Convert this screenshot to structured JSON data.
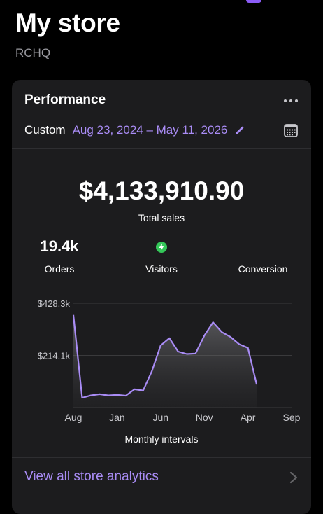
{
  "header": {
    "title": "My store",
    "subtitle": "RCHQ"
  },
  "card": {
    "title": "Performance",
    "more_icon": "more-horizontal-icon",
    "range_label": "Custom",
    "range_dates": "Aug 23, 2024 – May 11, 2026",
    "edit_icon": "pencil-icon",
    "calendar_icon": "calendar-icon",
    "total_value": "$4,133,910.90",
    "total_label": "Total sales",
    "metrics": [
      {
        "value": "19.4k",
        "label": "Orders"
      },
      {
        "value": "",
        "label": "Visitors",
        "icon": "lightning-badge-icon"
      },
      {
        "value": "",
        "label": "Conversion"
      }
    ],
    "interval_label": "Monthly intervals",
    "footer_link": "View all store analytics",
    "footer_icon": "chevron-right-icon"
  },
  "colors": {
    "accent": "#a98cf5",
    "line": "#a98cf5",
    "badge": "#34c759"
  },
  "chart_data": {
    "type": "area",
    "x_tick_labels": [
      "Aug",
      "Jan",
      "Jun",
      "Nov",
      "Apr",
      "Sep"
    ],
    "y_tick_labels": [
      "$428.3k",
      "$214.1k"
    ],
    "y_ticks": [
      428300,
      214100
    ],
    "ylim": [
      0,
      428300
    ],
    "xlabel": "Monthly intervals",
    "grid": true,
    "x": [
      "2024-08",
      "2024-09",
      "2024-10",
      "2024-11",
      "2024-12",
      "2025-01",
      "2025-02",
      "2025-03",
      "2025-04",
      "2025-05",
      "2025-06",
      "2025-07",
      "2025-08",
      "2025-09",
      "2025-10",
      "2025-11",
      "2025-12",
      "2026-01",
      "2026-02",
      "2026-03",
      "2026-04",
      "2026-05"
    ],
    "values": [
      380000,
      40000,
      50000,
      55000,
      50000,
      52000,
      49000,
      75000,
      70000,
      150000,
      255000,
      285000,
      230000,
      220000,
      222000,
      295000,
      350000,
      310000,
      290000,
      260000,
      245000,
      95000
    ]
  }
}
